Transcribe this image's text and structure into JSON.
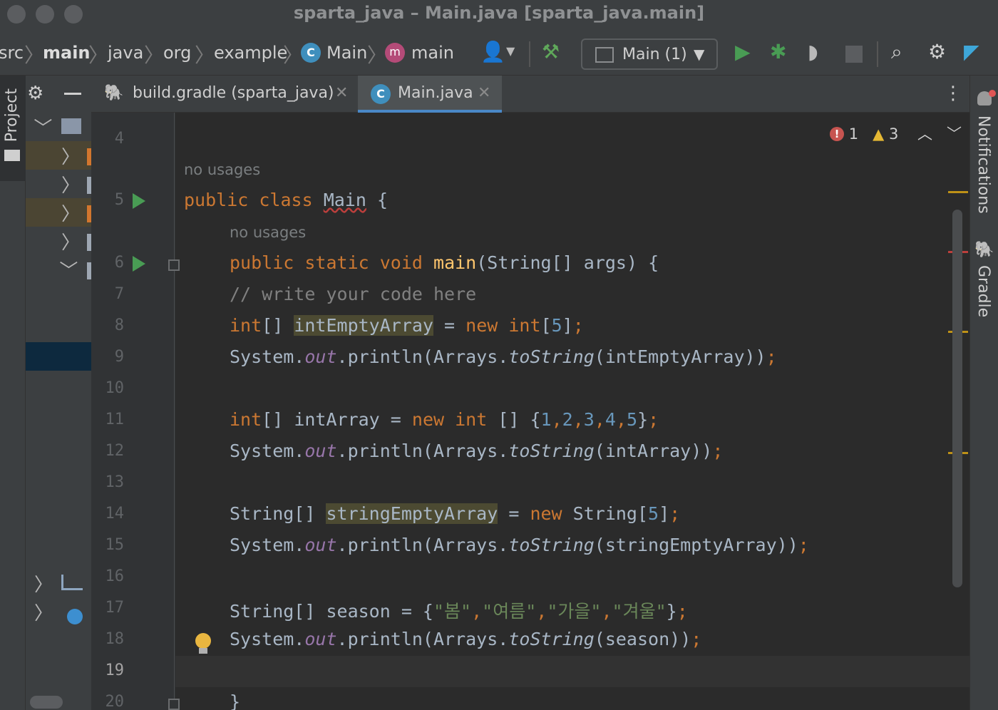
{
  "window": {
    "title": "sparta_java – Main.java [sparta_java.main]"
  },
  "breadcrumbs": [
    "src",
    "main",
    "java",
    "org",
    "example",
    "Main",
    "main"
  ],
  "toolbar": {
    "run_config": "Main (1)"
  },
  "left_stripe": {
    "project_label": "Project"
  },
  "right_stripe": {
    "notifications_label": "Notifications",
    "gradle_label": "Gradle"
  },
  "tabs": [
    {
      "label": "build.gradle (sparta_java)",
      "active": false
    },
    {
      "label": "Main.java",
      "active": true
    }
  ],
  "inspections": {
    "errors": "1",
    "warnings": "3"
  },
  "editor": {
    "usage_hint": "no usages",
    "line_numbers": [
      "4",
      "5",
      "6",
      "7",
      "8",
      "9",
      "10",
      "11",
      "12",
      "13",
      "14",
      "15",
      "16",
      "17",
      "18",
      "19",
      "20"
    ],
    "current_line": "19",
    "code": {
      "class_decl": [
        "public",
        "class",
        "Main",
        "{"
      ],
      "main_decl": [
        "public",
        "static",
        "void",
        "main",
        "(String[] args) {"
      ],
      "comment": "// write your code here",
      "var_int_empty": "intEmptyArray",
      "var_int": "intArray",
      "var_string_empty": "stringEmptyArray",
      "var_season": "season",
      "seasons": [
        "\"봄\"",
        "\"여름\"",
        "\"가을\"",
        "\"겨울\""
      ],
      "int_values": [
        "1",
        "2",
        "3",
        "4",
        "5"
      ],
      "size": "5",
      "closing": "}"
    }
  },
  "colors": {
    "keyword": "#cc7832",
    "method": "#ffc66d",
    "number": "#6897bb",
    "string": "#6a8759",
    "field": "#9876aa",
    "run": "#499c54",
    "accent": "#4a88c7"
  }
}
